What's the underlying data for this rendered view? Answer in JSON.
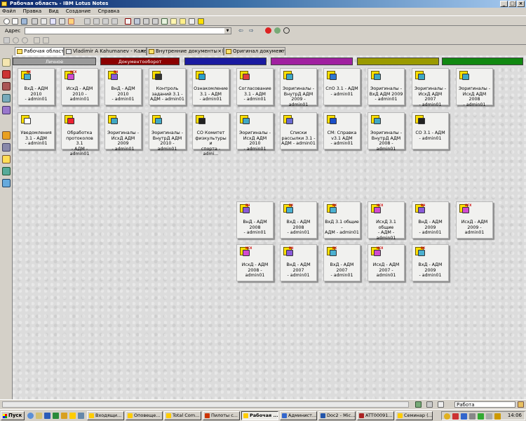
{
  "window": {
    "title": "Рабочая область - IBM Lotus Notes"
  },
  "menu": [
    "Файл",
    "Правка",
    "Вид",
    "Создание",
    "Справка"
  ],
  "address": {
    "label": "Адрес",
    "value": ""
  },
  "tabs": [
    {
      "label": "Рабочая область",
      "active": true,
      "closable": false
    },
    {
      "label": "Vladimir A Kahumanev - Календ...",
      "active": false,
      "closable": true
    },
    {
      "label": "Внутренние документы - РКК",
      "active": false,
      "closable": true
    },
    {
      "label": "Оригинал документа",
      "active": false,
      "closable": true
    }
  ],
  "workspace_tabs": [
    {
      "label": "Личное",
      "color": "#9a9a9a"
    },
    {
      "label": "Документооборот",
      "color": "#8b0000"
    },
    {
      "label": "",
      "color": "#1a1aa0"
    },
    {
      "label": "",
      "color": "#a020a0"
    },
    {
      "label": "",
      "color": "#9a9a00"
    },
    {
      "label": "",
      "color": "#118811"
    }
  ],
  "databases_top": [
    {
      "lines": [
        "ВхД - АДМ 2010",
        "- admin01"
      ],
      "icon": "incoming-doc-icon",
      "tag": "ВХ"
    },
    {
      "lines": [
        "ИсхД - АДМ",
        "2010 - admin01"
      ],
      "icon": "outgoing-doc-icon",
      "tag": "ИСХ"
    },
    {
      "lines": [
        "ВнД - АДМ 2010",
        "- admin01"
      ],
      "icon": "internal-doc-icon",
      "tag": "ВН"
    },
    {
      "lines": [
        "Контроль",
        "заданий 3.1 -",
        "АДМ - admin01"
      ],
      "icon": "control-task-icon",
      "tag": ""
    },
    {
      "lines": [
        "Ознакомление",
        "3.1 - АДМ",
        "- admin01"
      ],
      "icon": "acquaintance-icon",
      "tag": ""
    },
    {
      "lines": [
        "Согласование",
        "3.1 - АДМ",
        "- admin01"
      ],
      "icon": "approval-icon",
      "tag": ""
    },
    {
      "lines": [
        "Эоригиналы -",
        "ВнутрД АДМ",
        "2009 - admin01"
      ],
      "icon": "originals-icon",
      "tag": ""
    },
    {
      "lines": [
        "СпО 3.1 - АДМ",
        "- admin01"
      ],
      "icon": "reference-icon",
      "tag": ""
    },
    {
      "lines": [
        "Эоригиналы -",
        "ВхД АДМ 2009",
        "- admin01"
      ],
      "icon": "originals-icon",
      "tag": ""
    },
    {
      "lines": [
        "Эоригиналы -",
        "ИсхД АДМ 2007",
        "- admin01"
      ],
      "icon": "originals-icon",
      "tag": ""
    },
    {
      "lines": [
        "Эоригиналы -",
        "ИсхД АДМ 2008",
        "- admin01"
      ],
      "icon": "originals-icon",
      "tag": ""
    },
    {
      "lines": [
        "Уведомления",
        "3.1 - АДМ",
        "- admin01"
      ],
      "icon": "notification-icon",
      "tag": ""
    },
    {
      "lines": [
        "Обработка",
        "протоколов 3.1",
        "- АДМ - admin01"
      ],
      "icon": "protocol-icon",
      "tag": ""
    },
    {
      "lines": [
        "Эоригиналы -",
        "ИсхД АДМ 2009",
        "- admin01"
      ],
      "icon": "originals-icon",
      "tag": ""
    },
    {
      "lines": [
        "Эоригиналы -",
        "ВнутрД АДМ",
        "2010 - admin01"
      ],
      "icon": "originals-icon",
      "tag": ""
    },
    {
      "lines": [
        "СО Комитет",
        "физкультуры и",
        "спорта - admi..."
      ],
      "icon": "committee-icon",
      "tag": ""
    },
    {
      "lines": [
        "Эоригиналы -",
        "ИсхД АДМ 2010",
        "- admin01"
      ],
      "icon": "originals-icon",
      "tag": ""
    },
    {
      "lines": [
        "Списки",
        "рассылки 3.1 -",
        "АДМ - admin01"
      ],
      "icon": "mailing-list-icon",
      "tag": ""
    },
    {
      "lines": [
        "СМ: Справка",
        "v3.1 АДМ",
        "- admin01"
      ],
      "icon": "help-question-icon",
      "tag": ""
    },
    {
      "lines": [
        "Эоригиналы -",
        "ВнутрД АДМ",
        "2008 - admin01"
      ],
      "icon": "originals-icon",
      "tag": ""
    },
    {
      "lines": [
        "СО 3.1 - АДМ",
        "- admin01"
      ],
      "icon": "so-database-icon",
      "tag": ""
    }
  ],
  "databases_bottom": [
    {
      "lines": [
        "ВнД - АДМ 2008",
        "- admin01"
      ],
      "icon": "internal-doc-icon",
      "tag": "ВН"
    },
    {
      "lines": [
        "ВхД - АДМ 2008",
        "- admin01"
      ],
      "icon": "incoming-doc-icon",
      "tag": "ВХ"
    },
    {
      "lines": [
        "ВхД 3.1 общие -",
        "АДМ - admin01"
      ],
      "icon": "incoming-doc-icon",
      "tag": "ВХ"
    },
    {
      "lines": [
        "ИсхД 3.1 общие",
        "- АДМ - admin01"
      ],
      "icon": "outgoing-doc-icon",
      "tag": "ИСХ"
    },
    {
      "lines": [
        "ВнД - АДМ 2009",
        "- admin01"
      ],
      "icon": "internal-doc-icon",
      "tag": "ВН"
    },
    {
      "lines": [
        "ИсхД - АДМ",
        "2009 - admin01"
      ],
      "icon": "outgoing-doc-icon",
      "tag": "ИСХ"
    },
    {
      "lines": [
        "ИсхД - АДМ",
        "2008 - admin01"
      ],
      "icon": "outgoing-doc-icon",
      "tag": "ИСХ"
    },
    {
      "lines": [
        "ВнД - АДМ 2007",
        "- admin01"
      ],
      "icon": "internal-doc-icon",
      "tag": "ВН"
    },
    {
      "lines": [
        "ВхД - АДМ 2007",
        "- admin01"
      ],
      "icon": "incoming-doc-icon",
      "tag": "ВХ"
    },
    {
      "lines": [
        "ИсхД - АДМ",
        "2007 - admin01"
      ],
      "icon": "outgoing-doc-icon",
      "tag": "ИСХ"
    },
    {
      "lines": [
        "ВхД - АДМ 2009",
        "- admin01"
      ],
      "icon": "incoming-doc-icon",
      "tag": "ВХ"
    }
  ],
  "status": {
    "location": "Работа"
  },
  "taskbar": {
    "start": "Пуск",
    "buttons": [
      {
        "label": "Входящи...",
        "color": "#ffcc00",
        "active": false
      },
      {
        "label": "Оповеще...",
        "color": "#ffcc00",
        "active": false
      },
      {
        "label": "Total Com...",
        "color": "#ffcc00",
        "active": false
      },
      {
        "label": "Пилоты с...",
        "color": "#cc3300",
        "active": false
      },
      {
        "label": "Рабочая ...",
        "color": "#ffcc00",
        "active": true
      },
      {
        "label": "Админист...",
        "color": "#3366cc",
        "active": false
      },
      {
        "label": "Doc2 - Mic...",
        "color": "#2255aa",
        "active": false
      },
      {
        "label": "ATT00091...",
        "color": "#aa2222",
        "active": false
      },
      {
        "label": "Семинар (...",
        "color": "#ffcc00",
        "active": false
      }
    ],
    "clock": "14:06"
  }
}
